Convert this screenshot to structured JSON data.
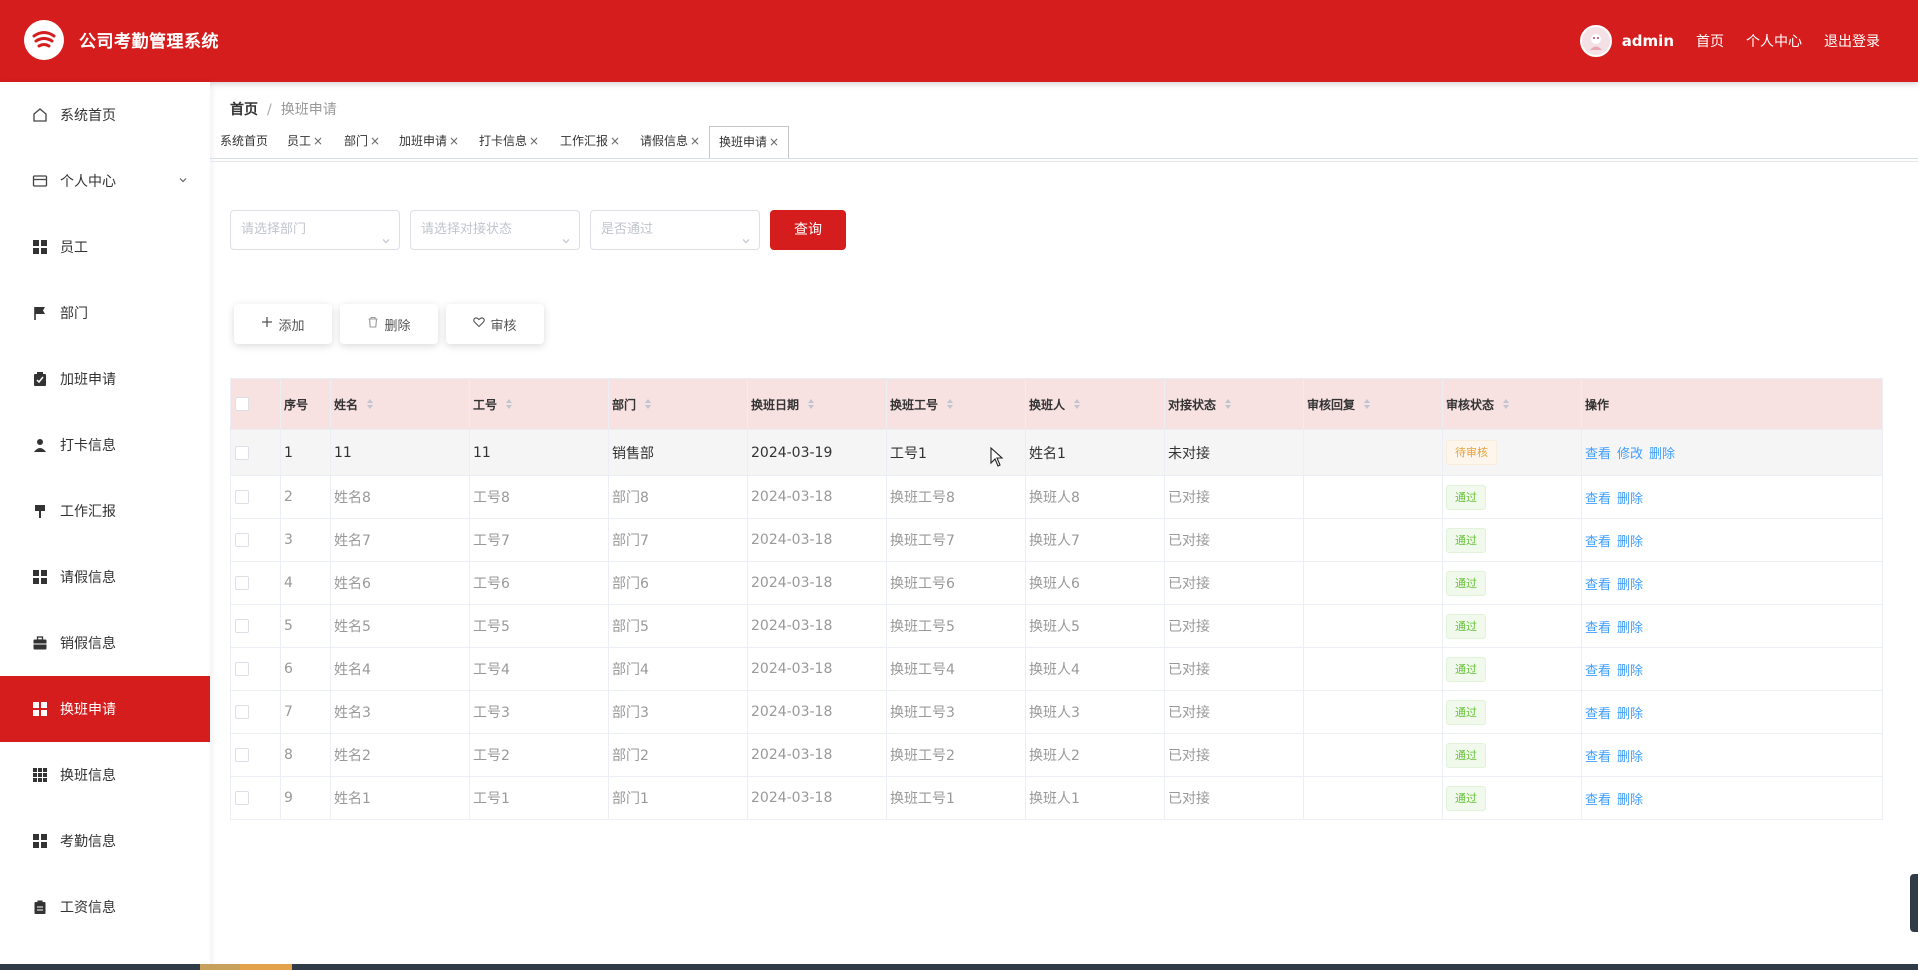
{
  "app": {
    "title": "公司考勤管理系统"
  },
  "header": {
    "username": "admin",
    "links": [
      "首页",
      "个人中心",
      "退出登录"
    ]
  },
  "sidebar": {
    "items": [
      {
        "label": "系统首页",
        "icon": "home-icon"
      },
      {
        "label": "个人中心",
        "icon": "wallet-icon"
      },
      {
        "label": "员工",
        "icon": "grid-icon"
      },
      {
        "label": "部门",
        "icon": "flag-icon"
      },
      {
        "label": "加班申请",
        "icon": "clipboard-check-icon"
      },
      {
        "label": "打卡信息",
        "icon": "person-icon"
      },
      {
        "label": "工作汇报",
        "icon": "signpost-icon"
      },
      {
        "label": "请假信息",
        "icon": "grid-icon"
      },
      {
        "label": "销假信息",
        "icon": "briefcase-icon"
      },
      {
        "label": "换班申请",
        "icon": "grid-icon"
      },
      {
        "label": "换班信息",
        "icon": "dots-grid-icon"
      },
      {
        "label": "考勤信息",
        "icon": "grid-icon"
      },
      {
        "label": "工资信息",
        "icon": "clipboard-icon"
      }
    ],
    "active": "换班申请"
  },
  "breadcrumb": {
    "home": "首页",
    "current": "换班申请"
  },
  "tabs": [
    "系统首页",
    "员工",
    "部门",
    "加班申请",
    "打卡信息",
    "工作汇报",
    "请假信息",
    "换班申请"
  ],
  "filters": {
    "department_placeholder": "请选择部门",
    "status_placeholder": "请选择对接状态",
    "pass_placeholder": "是否通过",
    "query_label": "查询"
  },
  "actions": {
    "add": "添加",
    "delete": "删除",
    "audit": "审核"
  },
  "table": {
    "headers": [
      "序号",
      "姓名",
      "工号",
      "部门",
      "换班日期",
      "换班工号",
      "换班人",
      "对接状态",
      "审核回复",
      "审核状态",
      "操作"
    ],
    "rows": [
      {
        "no": "1",
        "name": "11",
        "id": "11",
        "dept": "销售部",
        "date": "2024-03-19",
        "shift_id": "工号1",
        "shift_person": "姓名1",
        "dock": "未对接",
        "reply": "",
        "status": "待审核",
        "ops": [
          "查看",
          "修改",
          "删除"
        ]
      },
      {
        "no": "2",
        "name": "姓名8",
        "id": "工号8",
        "dept": "部门8",
        "date": "2024-03-18",
        "shift_id": "换班工号8",
        "shift_person": "换班人8",
        "dock": "已对接",
        "reply": "",
        "status": "通过",
        "ops": [
          "查看",
          "删除"
        ]
      },
      {
        "no": "3",
        "name": "姓名7",
        "id": "工号7",
        "dept": "部门7",
        "date": "2024-03-18",
        "shift_id": "换班工号7",
        "shift_person": "换班人7",
        "dock": "已对接",
        "reply": "",
        "status": "通过",
        "ops": [
          "查看",
          "删除"
        ]
      },
      {
        "no": "4",
        "name": "姓名6",
        "id": "工号6",
        "dept": "部门6",
        "date": "2024-03-18",
        "shift_id": "换班工号6",
        "shift_person": "换班人6",
        "dock": "已对接",
        "reply": "",
        "status": "通过",
        "ops": [
          "查看",
          "删除"
        ]
      },
      {
        "no": "5",
        "name": "姓名5",
        "id": "工号5",
        "dept": "部门5",
        "date": "2024-03-18",
        "shift_id": "换班工号5",
        "shift_person": "换班人5",
        "dock": "已对接",
        "reply": "",
        "status": "通过",
        "ops": [
          "查看",
          "删除"
        ]
      },
      {
        "no": "6",
        "name": "姓名4",
        "id": "工号4",
        "dept": "部门4",
        "date": "2024-03-18",
        "shift_id": "换班工号4",
        "shift_person": "换班人4",
        "dock": "已对接",
        "reply": "",
        "status": "通过",
        "ops": [
          "查看",
          "删除"
        ]
      },
      {
        "no": "7",
        "name": "姓名3",
        "id": "工号3",
        "dept": "部门3",
        "date": "2024-03-18",
        "shift_id": "换班工号3",
        "shift_person": "换班人3",
        "dock": "已对接",
        "reply": "",
        "status": "通过",
        "ops": [
          "查看",
          "删除"
        ]
      },
      {
        "no": "8",
        "name": "姓名2",
        "id": "工号2",
        "dept": "部门2",
        "date": "2024-03-18",
        "shift_id": "换班工号2",
        "shift_person": "换班人2",
        "dock": "已对接",
        "reply": "",
        "status": "通过",
        "ops": [
          "查看",
          "删除"
        ]
      },
      {
        "no": "9",
        "name": "姓名1",
        "id": "工号1",
        "dept": "部门1",
        "date": "2024-03-18",
        "shift_id": "换班工号1",
        "shift_person": "换班人1",
        "dock": "已对接",
        "reply": "",
        "status": "通过",
        "ops": [
          "查看",
          "删除"
        ]
      }
    ]
  },
  "colors": {
    "brand": "#d51d1d",
    "header_row": "#f7e1e1",
    "link": "#409eff",
    "pass": "#67c23a",
    "wait": "#e6a23c"
  }
}
